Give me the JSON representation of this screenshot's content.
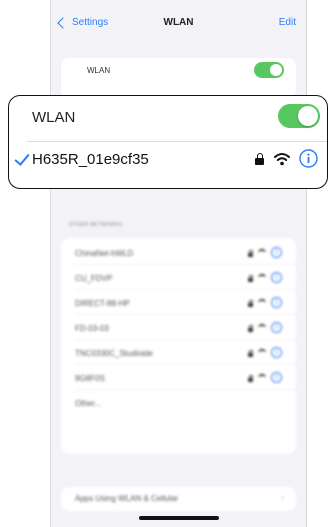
{
  "nav": {
    "back_label": "Settings",
    "title": "WLAN",
    "edit_label": "Edit"
  },
  "wlan_row": {
    "label": "WLAN",
    "toggle_on": true
  },
  "connected_network": {
    "name": "H635R_01e9cf35",
    "secured": true
  },
  "other_networks": {
    "header": "OTHER NETWORKS",
    "items": [
      {
        "name": "ChinaNet-hWLD"
      },
      {
        "name": "CU_FDVP"
      },
      {
        "name": "DIRECT-88-HP"
      },
      {
        "name": "FD-03-03"
      },
      {
        "name": "TNC0330C_Studioide"
      },
      {
        "name": "9G8F0S"
      }
    ],
    "other_label": "Other..."
  },
  "apps_row": {
    "label": "Apps Using WLAN & Cellular"
  },
  "colors": {
    "accent": "#2f7bf6",
    "toggle_green": "#57c75f",
    "background": "#f2f2f7"
  }
}
